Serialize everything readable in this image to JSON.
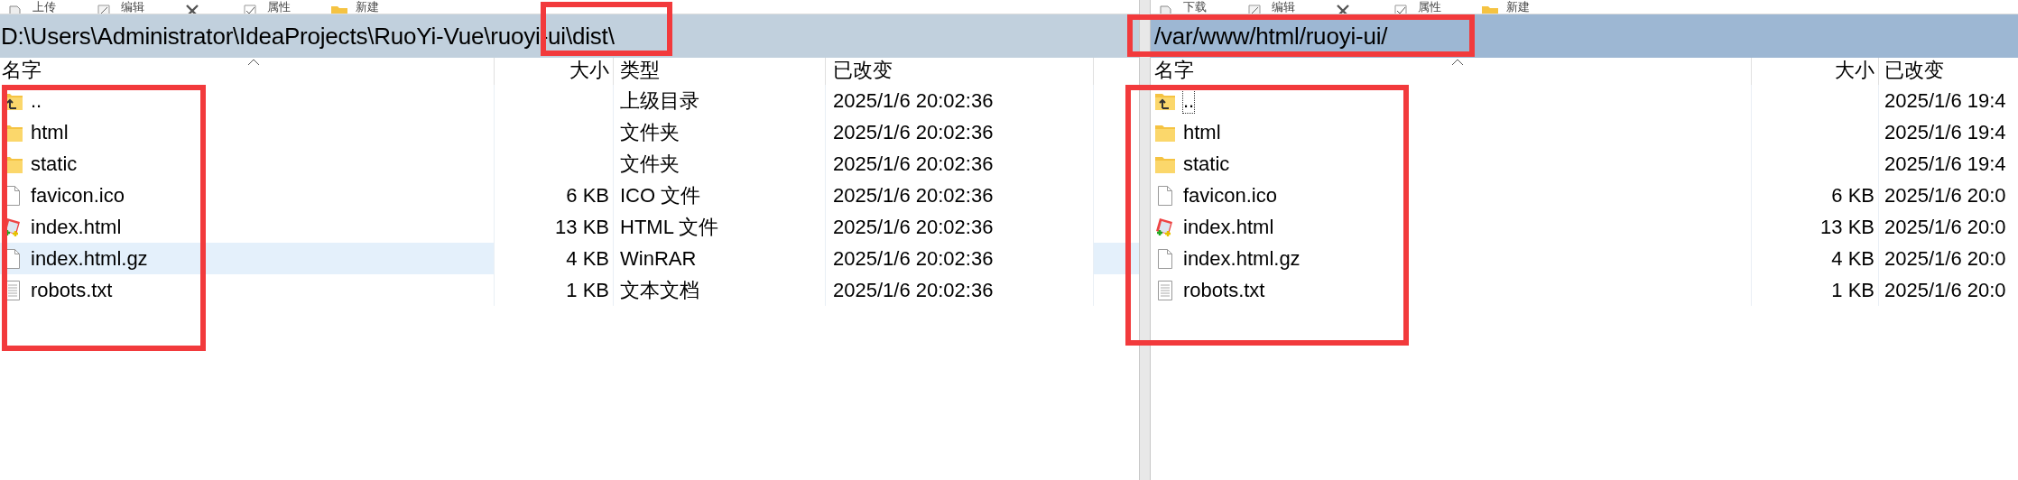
{
  "panes": [
    {
      "active": false,
      "toolbar": [
        {
          "kind": "upload",
          "label": "上传"
        },
        {
          "kind": "edit",
          "label": "编辑"
        },
        {
          "kind": "delete"
        },
        {
          "kind": "properties",
          "label": "属性"
        },
        {
          "kind": "new",
          "label": "新建"
        }
      ],
      "path": "D:\\Users\\Administrator\\IdeaProjects\\RuoYi-Vue\\ruoyi-ui\\dist\\",
      "columns": [
        {
          "kind": "name",
          "label": "名字",
          "sorted": true
        },
        {
          "kind": "size",
          "label": "大小",
          "sorted": false
        },
        {
          "kind": "type",
          "label": "类型",
          "sorted": false
        },
        {
          "kind": "modified",
          "label": "已改变",
          "sorted": false
        }
      ],
      "rows": [
        {
          "kind": "parent",
          "name": "..",
          "type": "上级目录",
          "modified": "2025/1/6 20:02:36",
          "selected": false,
          "focused": false
        },
        {
          "kind": "folder",
          "name": "html",
          "type": "文件夹",
          "modified": "2025/1/6 20:02:36",
          "selected": false,
          "focused": false
        },
        {
          "kind": "folder",
          "name": "static",
          "type": "文件夹",
          "modified": "2025/1/6 20:02:36",
          "selected": false,
          "focused": false
        },
        {
          "kind": "file",
          "name": "favicon.ico",
          "size": "6 KB",
          "type": "ICO 文件",
          "modified": "2025/1/6 20:02:36",
          "selected": false,
          "focused": false
        },
        {
          "kind": "notepad",
          "name": "index.html",
          "size": "13 KB",
          "type": "HTML 文件",
          "modified": "2025/1/6 20:02:36",
          "selected": false,
          "focused": false
        },
        {
          "kind": "file",
          "name": "index.html.gz",
          "size": "4 KB",
          "type": "WinRAR",
          "modified": "2025/1/6 20:02:36",
          "selected": true,
          "focused": false
        },
        {
          "kind": "text",
          "name": "robots.txt",
          "size": "1 KB",
          "type": "文本文档",
          "modified": "2025/1/6 20:02:36",
          "selected": false,
          "focused": false
        }
      ]
    },
    {
      "active": true,
      "toolbar": [
        {
          "kind": "download",
          "label": "下载"
        },
        {
          "kind": "edit",
          "label": "编辑"
        },
        {
          "kind": "delete"
        },
        {
          "kind": "properties",
          "label": "属性"
        },
        {
          "kind": "new",
          "label": "新建"
        }
      ],
      "path": "/var/www/html/ruoyi-ui/",
      "columns": [
        {
          "kind": "name",
          "label": "名字",
          "sorted": true
        },
        {
          "kind": "size",
          "label": "大小",
          "sorted": false
        },
        {
          "kind": "modified",
          "label": "已改变",
          "sorted": false
        }
      ],
      "rows": [
        {
          "kind": "parent",
          "name": "..",
          "modified": "2025/1/6 19:4",
          "selected": false,
          "focused": true
        },
        {
          "kind": "folder",
          "name": "html",
          "modified": "2025/1/6 19:4",
          "selected": false,
          "focused": false
        },
        {
          "kind": "folder",
          "name": "static",
          "modified": "2025/1/6 19:4",
          "selected": false,
          "focused": false
        },
        {
          "kind": "file",
          "name": "favicon.ico",
          "size": "6 KB",
          "modified": "2025/1/6 20:0",
          "selected": false,
          "focused": false
        },
        {
          "kind": "notepad",
          "name": "index.html",
          "size": "13 KB",
          "modified": "2025/1/6 20:0",
          "selected": false,
          "focused": false
        },
        {
          "kind": "file",
          "name": "index.html.gz",
          "size": "4 KB",
          "modified": "2025/1/6 20:0",
          "selected": false,
          "focused": false
        },
        {
          "kind": "text",
          "name": "robots.txt",
          "size": "1 KB",
          "modified": "2025/1/6 20:0",
          "selected": false,
          "focused": false
        }
      ]
    }
  ],
  "annotations": [
    {
      "kind": "box"
    },
    {
      "kind": "box"
    },
    {
      "kind": "box"
    },
    {
      "kind": "box"
    }
  ]
}
